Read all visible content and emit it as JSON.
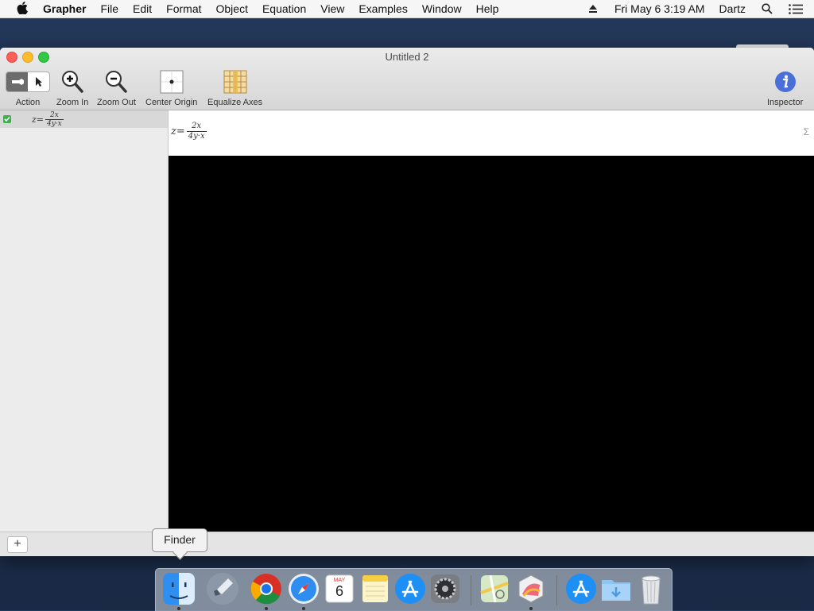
{
  "menubar": {
    "app_name": "Grapher",
    "menus": [
      "File",
      "Edit",
      "Format",
      "Object",
      "Equation",
      "View",
      "Examples",
      "Window",
      "Help"
    ],
    "datetime": "Fri May 6  3:19 AM",
    "user": "Dartz"
  },
  "window": {
    "title": "Untitled 2",
    "toolbar": {
      "action": "Action",
      "zoom_in": "Zoom In",
      "zoom_out": "Zoom Out",
      "center_origin": "Center Origin",
      "equalize_axes": "Equalize Axes",
      "inspector": "Inspector"
    },
    "sidebar": {
      "equations": [
        {
          "lhs": "z=",
          "numerator": "2x",
          "denominator": "4y·x",
          "checked": true
        }
      ]
    },
    "editor": {
      "lhs": "z=",
      "numerator": "2x",
      "denominator": "4y·x",
      "palette_hint": "Σ"
    },
    "add_button": "+"
  },
  "tooltip": {
    "text": "Finder"
  },
  "dock": {
    "items": [
      "Finder",
      "Launchpad",
      "Google Chrome",
      "Safari",
      "Calendar",
      "Notes",
      "App Store",
      "System Preferences",
      "Maps",
      "Grapher",
      "App Store",
      "Downloads",
      "Trash"
    ],
    "calendar": {
      "month": "MAY",
      "day": "6"
    }
  },
  "colors": {
    "graph_background": "#000000",
    "checkbox": "#3db04c",
    "close": "#fc5f57",
    "minimize": "#fdbc2e",
    "zoom": "#33c748"
  }
}
